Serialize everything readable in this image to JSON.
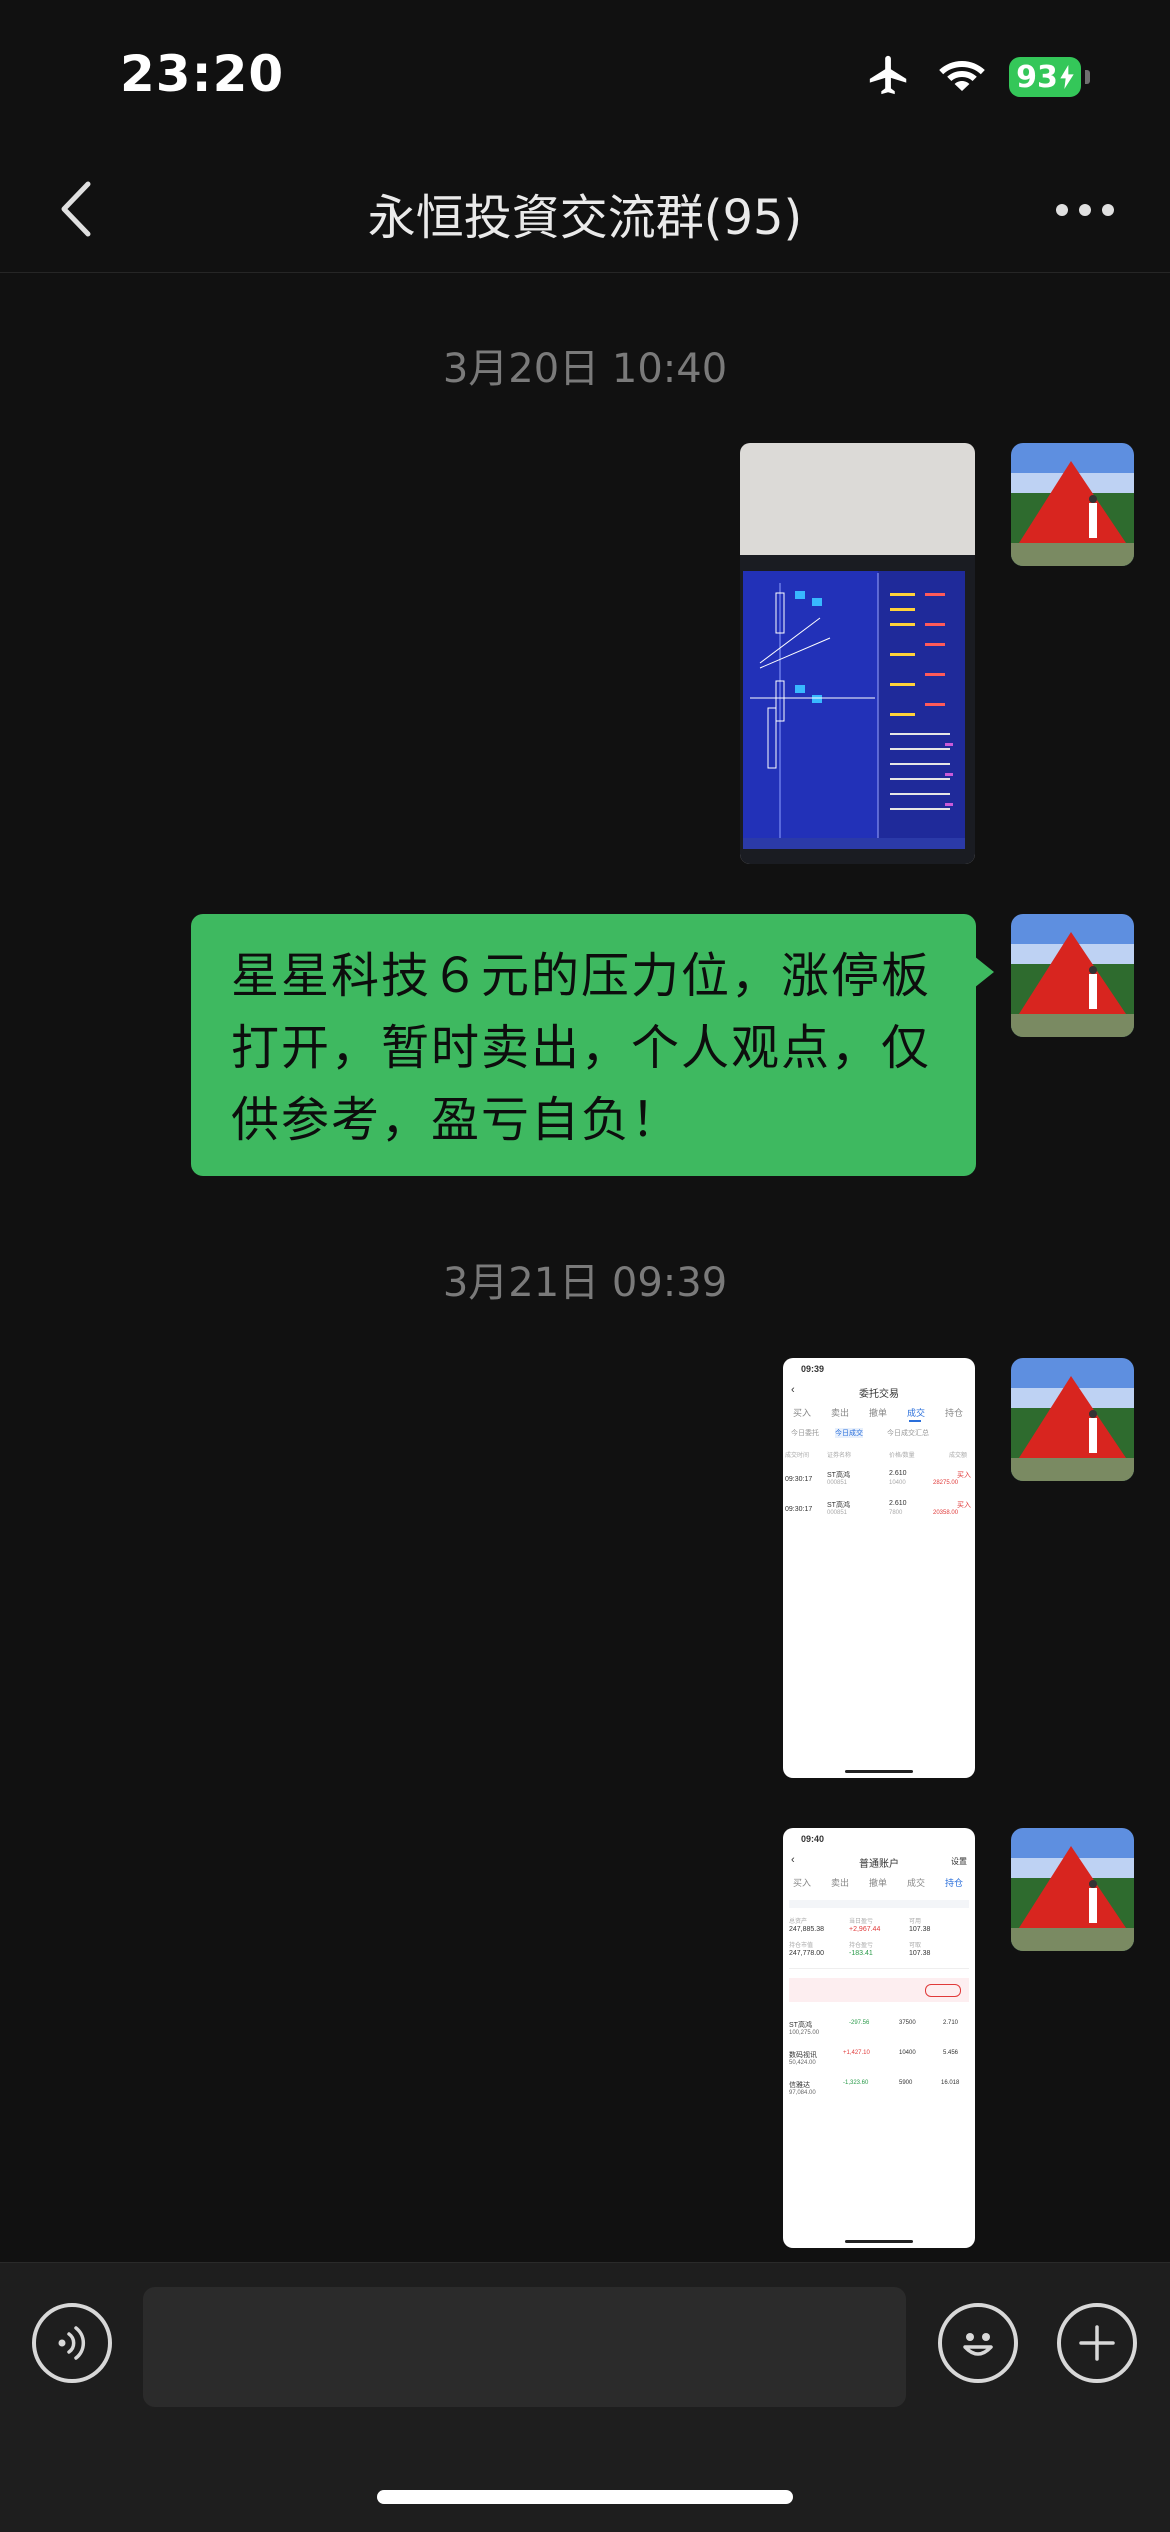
{
  "status_bar": {
    "time": "23:20",
    "battery": "93",
    "icons": [
      "airplane-icon",
      "wifi-icon",
      "battery-charging-icon"
    ]
  },
  "nav": {
    "title": "永恒投資交流群(95)",
    "icons": [
      "chevron-left-icon",
      "more-dots-icon"
    ]
  },
  "messages": {
    "time1": "3月20日 10:40",
    "bubble": {
      "line1": "星星科技６元的压力位，涨停板",
      "line2": "打开，暂时卖出，个人观点，仅",
      "line3": "供参考，盈亏自负！"
    },
    "time2": "3月21日 09:39",
    "shot1": {
      "time": "09:39",
      "title": "委托交易",
      "tabs": [
        "买入",
        "卖出",
        "撤单",
        "成交",
        "持仓"
      ],
      "filters": [
        "今日委托",
        "今日成交",
        "今日成交汇总"
      ],
      "headers": [
        "成交时间",
        "证券名称",
        "价格/数量",
        "成交额"
      ],
      "rows": [
        {
          "time": "09:30:17",
          "name": "ST高鸿",
          "code": "000851",
          "price": "2.610",
          "qty": "10400",
          "side": "买入",
          "amount": "28275.00"
        },
        {
          "time": "09:30:17",
          "name": "ST高鸿",
          "code": "000851",
          "price": "2.610",
          "qty": "7800",
          "side": "买入",
          "amount": "20358.00"
        }
      ]
    },
    "shot2": {
      "time": "09:40",
      "title": "普通账户",
      "settings": "设置",
      "tabs": [
        "买入",
        "卖出",
        "撤单",
        "成交",
        "持仓"
      ],
      "summary": [
        {
          "label": "总资产",
          "value": "247,885.38"
        },
        {
          "label": "当日盈亏",
          "value": "+2,967.44"
        },
        {
          "label": "可用",
          "value": "107.38"
        },
        {
          "label": "持仓市值",
          "value": "247,778.00"
        },
        {
          "label": "持仓盈亏",
          "value": "-183.41"
        },
        {
          "label": "可取",
          "value": "107.38"
        }
      ],
      "holdings": [
        {
          "name": "ST高鸿",
          "value": "100,275.00",
          "pnl": "-297.56",
          "qty": "37500",
          "price": "2.710"
        },
        {
          "name": "数码视讯",
          "value": "50,424.00",
          "pnl": "+1,427.10",
          "qty": "10400",
          "price": "5.456"
        },
        {
          "name": "信雅达",
          "value": "97,084.00",
          "pnl": "-1,323.60",
          "qty": "5900",
          "price": "16.018"
        }
      ]
    }
  },
  "input": {
    "placeholder": "",
    "icons": [
      "voice-icon",
      "emoji-icon",
      "plus-icon"
    ]
  }
}
